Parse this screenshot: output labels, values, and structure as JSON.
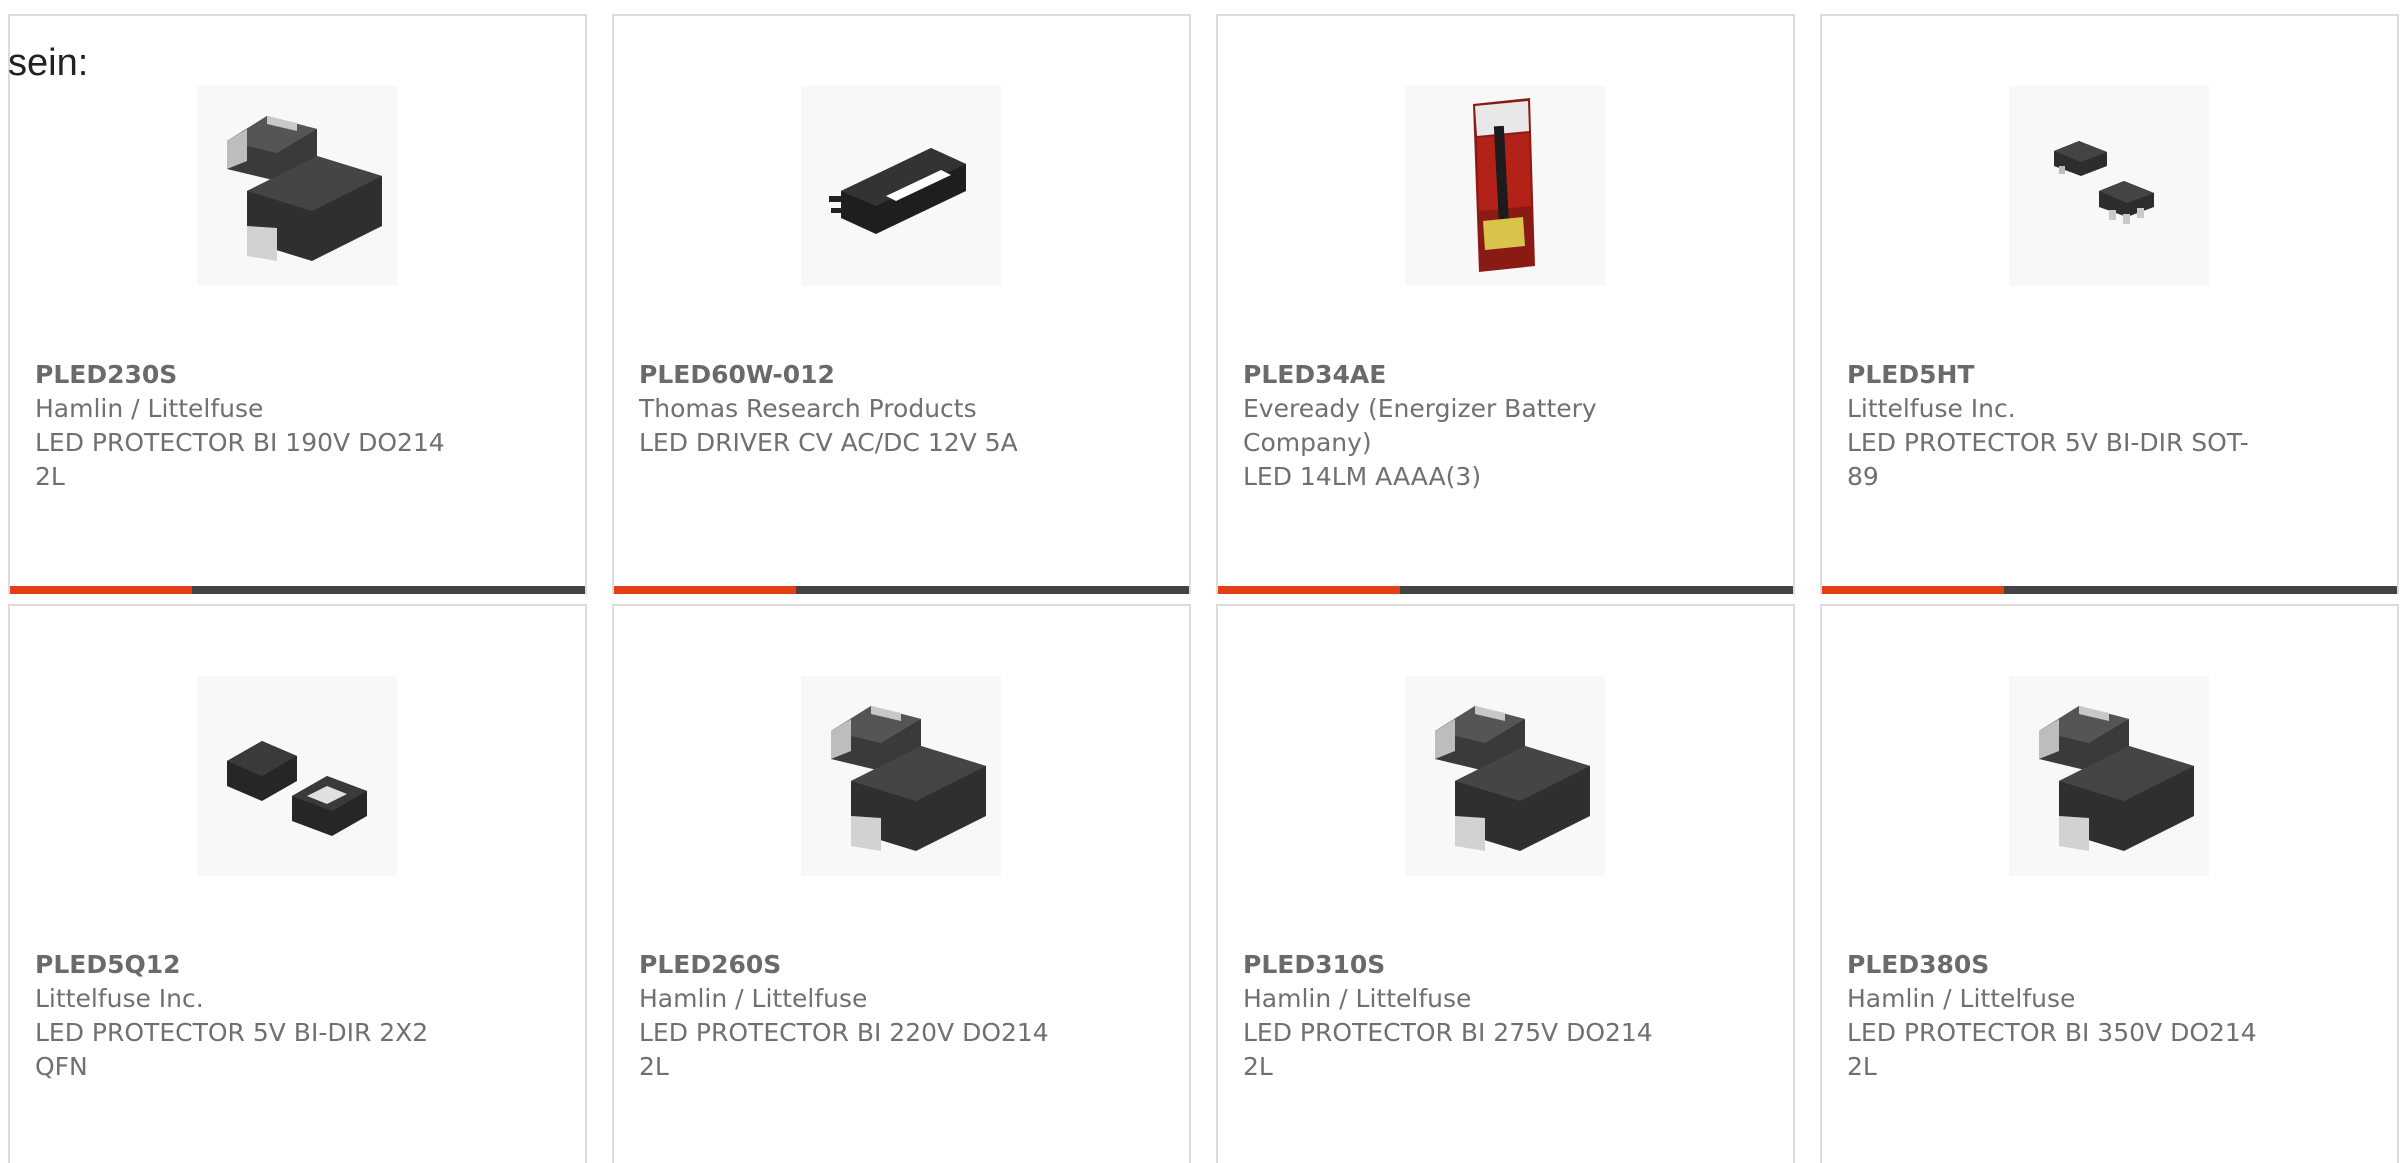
{
  "intro_text": "sein:",
  "colors": {
    "accent": "#e23f14",
    "bar_dark": "#444444",
    "text": "#707070",
    "border": "#dcdcdc"
  },
  "products": [
    {
      "part_number": "PLED230S",
      "manufacturer": "Hamlin / Littelfuse",
      "description": "LED PROTECTOR BI 190V DO214 2L",
      "image_icon": "do214-diode-package-icon"
    },
    {
      "part_number": "PLED60W-012",
      "manufacturer": "Thomas Research Products",
      "description": "LED DRIVER CV AC/DC 12V 5A",
      "image_icon": "led-driver-box-icon"
    },
    {
      "part_number": "PLED34AE",
      "manufacturer": "Eveready (Energizer Battery Company)",
      "description": "LED 14LM AAAA(3)",
      "image_icon": "penlight-blister-pack-icon"
    },
    {
      "part_number": "PLED5HT",
      "manufacturer": "Littelfuse Inc.",
      "description": "LED PROTECTOR 5V BI-DIR SOT-89",
      "image_icon": "sot89-package-icon"
    },
    {
      "part_number": "PLED5Q12",
      "manufacturer": "Littelfuse Inc.",
      "description": "LED PROTECTOR 5V BI-DIR 2X2 QFN",
      "image_icon": "qfn-package-icon"
    },
    {
      "part_number": "PLED260S",
      "manufacturer": "Hamlin / Littelfuse",
      "description": "LED PROTECTOR BI 220V DO214 2L",
      "image_icon": "do214-diode-package-icon"
    },
    {
      "part_number": "PLED310S",
      "manufacturer": "Hamlin / Littelfuse",
      "description": "LED PROTECTOR BI 275V DO214 2L",
      "image_icon": "do214-diode-package-icon"
    },
    {
      "part_number": "PLED380S",
      "manufacturer": "Hamlin / Littelfuse",
      "description": "LED PROTECTOR BI 350V DO214 2L",
      "image_icon": "do214-diode-package-icon"
    }
  ]
}
